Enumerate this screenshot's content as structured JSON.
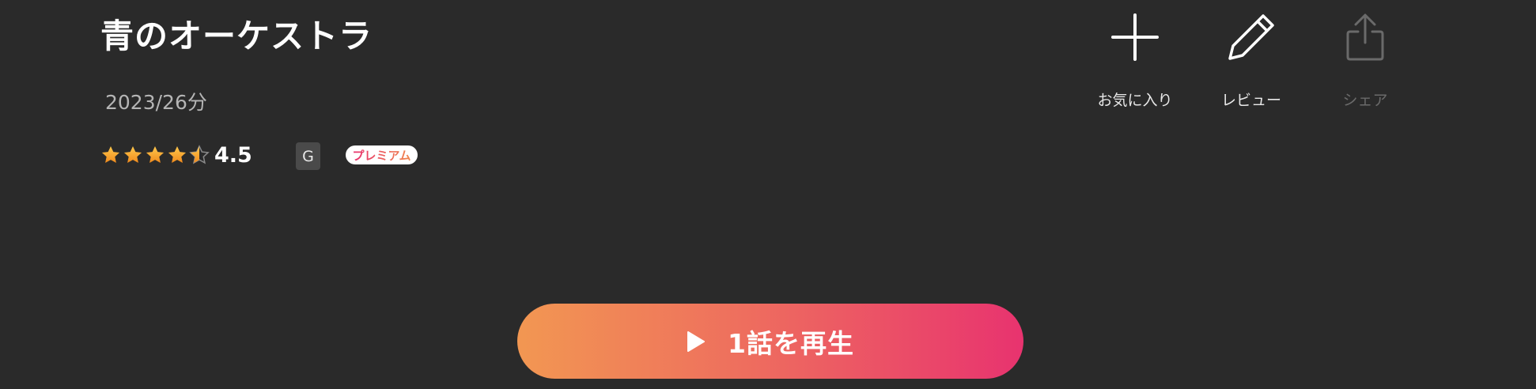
{
  "title": "青のオーケストラ",
  "meta": "2023/26分",
  "rating": {
    "value": 4.5,
    "value_text": "4.5",
    "max": 5,
    "star_color": "#f6a623"
  },
  "age_rating": "G",
  "premium_label": "プレミアム",
  "actions": {
    "favorite_label": "お気に入り",
    "review_label": "レビュー",
    "share_label": "シェア"
  },
  "play_button": {
    "label": "1話を再生"
  },
  "colors": {
    "background": "#2a2a2a",
    "accent_start": "#f29752",
    "accent_end": "#e8336f"
  }
}
